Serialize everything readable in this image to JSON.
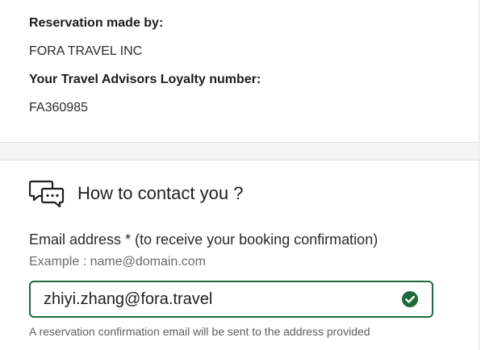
{
  "reservation": {
    "made_by_label": "Reservation made by:",
    "made_by_value": "FORA TRAVEL INC",
    "loyalty_label": "Your Travel Advisors Loyalty number:",
    "loyalty_value": "FA360985"
  },
  "contact": {
    "icon": "chat-bubbles-icon",
    "title": "How to contact you ?"
  },
  "email": {
    "label": "Email address * (to receive your booking confirmation)",
    "example": "Example : name@domain.com",
    "value": "zhiyi.zhang@fora.travel",
    "valid_icon": "check-circle-icon",
    "help_text": "A reservation confirmation email will be sent to the address provided"
  },
  "colors": {
    "accent_green": "#1e6a3d",
    "valid_green": "#1e6a3d"
  }
}
